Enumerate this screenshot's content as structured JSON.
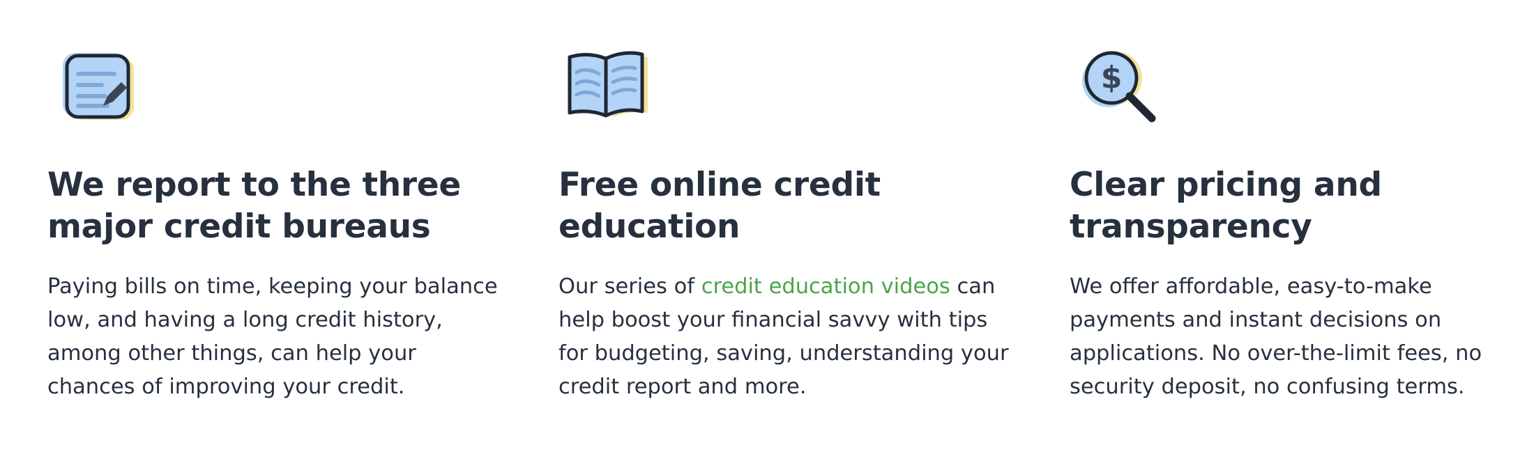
{
  "features": [
    {
      "icon": "document-edit-icon",
      "title": "We report to the three major credit bureaus",
      "body": "Paying bills on time, keeping your balance low, and having a long credit history, among other things, can help your chances of improving your credit."
    },
    {
      "icon": "open-book-icon",
      "title": "Free online credit education",
      "body_prefix": "Our series of ",
      "link_text": "credit education videos",
      "body_suffix": " can help boost your financial savvy with tips for budgeting, saving, understanding your credit report and more."
    },
    {
      "icon": "dollar-magnifier-icon",
      "title": "Clear pricing and transparency",
      "body": "We offer affordable, easy-to-make payments and instant decisions on applications. No over-the-limit fees, no security deposit, no confusing terms."
    }
  ],
  "colors": {
    "text": "#26303e",
    "link": "#4aa547",
    "icon_fill": "#b3d3f7",
    "icon_accent": "#f7e19a",
    "icon_stroke": "#1f2733"
  }
}
